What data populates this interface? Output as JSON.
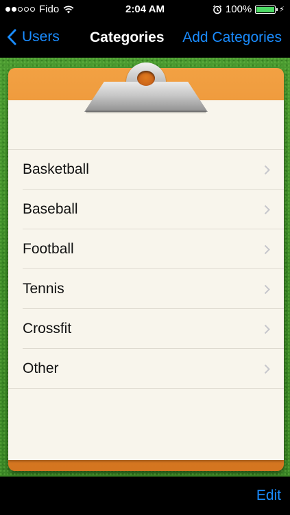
{
  "status_bar": {
    "carrier": "Fido",
    "time": "2:04 AM",
    "battery": "100%",
    "battery_level": 1.0,
    "signal_bars": 2,
    "signal_total": 5,
    "icons": [
      "signal-dots-icon",
      "wifi-icon",
      "alarm-icon",
      "battery-icon",
      "charging-bolt-icon"
    ]
  },
  "nav": {
    "back_label": "Users",
    "title": "Categories",
    "right_label": "Add Categories"
  },
  "categories": [
    {
      "label": "Basketball"
    },
    {
      "label": "Baseball"
    },
    {
      "label": "Football"
    },
    {
      "label": "Tennis"
    },
    {
      "label": "Crossfit"
    },
    {
      "label": "Other"
    }
  ],
  "toolbar": {
    "edit_label": "Edit"
  },
  "colors": {
    "accent": "#1a8cff",
    "grass": "#3d8b28",
    "clipboard": "#e4852a",
    "paper": "#f8f5ec"
  }
}
